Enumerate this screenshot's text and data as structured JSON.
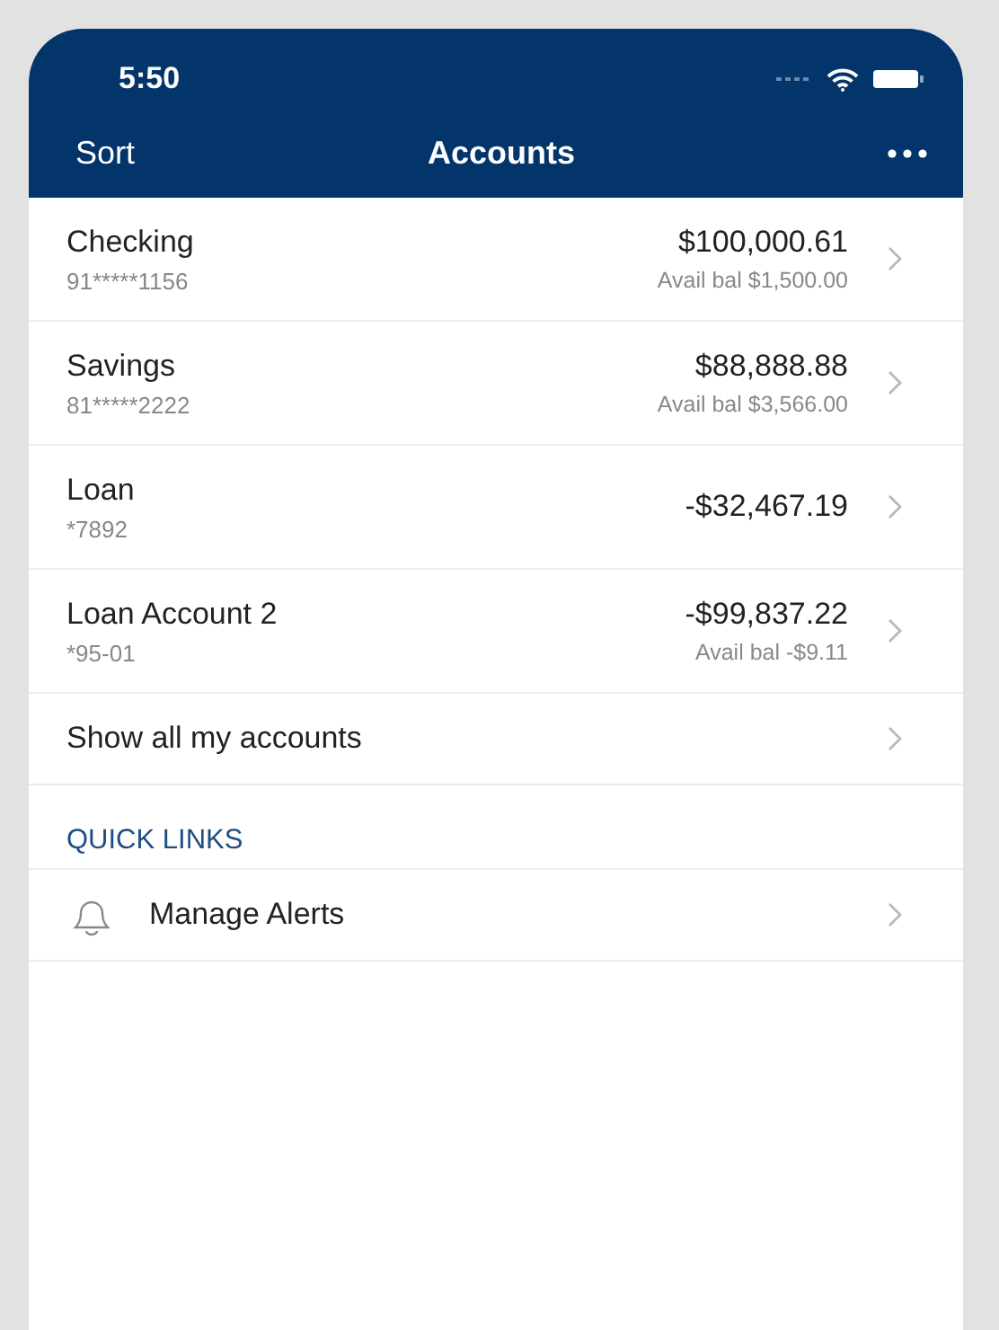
{
  "status_bar": {
    "time": "5:50"
  },
  "nav_bar": {
    "left": "Sort",
    "title": "Accounts"
  },
  "accounts": [
    {
      "name": "Checking",
      "number": "91*****1156",
      "balance": "$100,000.61",
      "available": "Avail bal $1,500.00"
    },
    {
      "name": "Savings",
      "number": "81*****2222",
      "balance": "$88,888.88",
      "available": "Avail bal $3,566.00"
    },
    {
      "name": "Loan",
      "number": "*7892",
      "balance": "-$32,467.19"
    },
    {
      "name": "Loan Account 2",
      "number": "*95-01",
      "balance": "-$99,837.22",
      "available": "Avail bal -$9.11"
    }
  ],
  "show_all": "Show all my accounts",
  "quick_links": {
    "heading": "QUICK LINKS",
    "items": [
      {
        "label": "Manage Alerts"
      }
    ]
  }
}
